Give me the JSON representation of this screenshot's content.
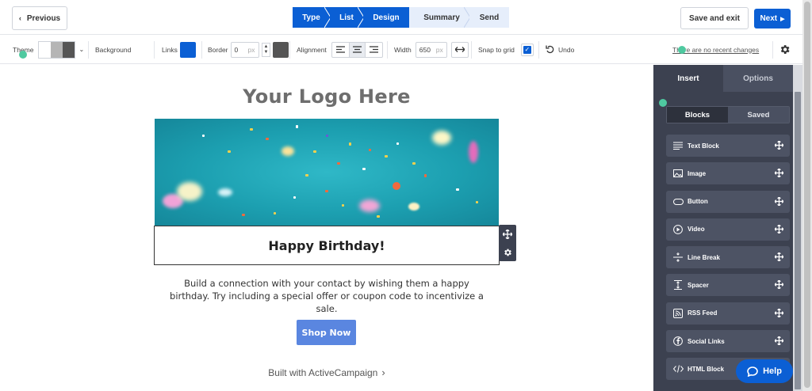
{
  "topbar": {
    "previous_label": "Previous",
    "steps": [
      {
        "label": "Type",
        "state": "done"
      },
      {
        "label": "List",
        "state": "done"
      },
      {
        "label": "Design",
        "state": "current"
      },
      {
        "label": "Summary",
        "state": "upcoming"
      },
      {
        "label": "Send",
        "state": "upcoming"
      }
    ],
    "save_exit_label": "Save and exit",
    "next_label": "Next"
  },
  "toolbar": {
    "theme_label": "Theme",
    "background_label": "Background",
    "links_label": "Links",
    "links_color": "#0b5fd4",
    "border_label": "Border",
    "border_value": "0",
    "border_unit": "px",
    "alignment_label": "Alignment",
    "width_label": "Width",
    "width_value": "650",
    "width_unit": "px",
    "snap_label": "Snap to grid",
    "snap_checked": true,
    "undo_label": "Undo",
    "recent_changes": "There are no recent changes"
  },
  "email": {
    "logo_text": "Your Logo Here",
    "headline": "Happy Birthday!",
    "body": "Build a connection with your contact by wishing them a happy birthday. Try including a special offer or coupon code to incentivize a sale.",
    "cta_label": "Shop Now",
    "footer": "Built with ActiveCampaign"
  },
  "panel": {
    "tabs": [
      "Insert",
      "Options"
    ],
    "active_tab": "Insert",
    "segments": [
      "Blocks",
      "Saved"
    ],
    "active_segment": "Blocks",
    "blocks": [
      {
        "label": "Text Block",
        "icon": "text-lines-icon"
      },
      {
        "label": "Image",
        "icon": "image-icon"
      },
      {
        "label": "Button",
        "icon": "button-pill-icon"
      },
      {
        "label": "Video",
        "icon": "play-circle-icon"
      },
      {
        "label": "Line Break",
        "icon": "line-break-icon"
      },
      {
        "label": "Spacer",
        "icon": "spacer-icon"
      },
      {
        "label": "RSS Feed",
        "icon": "rss-icon"
      },
      {
        "label": "Social Links",
        "icon": "social-icon"
      },
      {
        "label": "HTML Block",
        "icon": "code-icon"
      }
    ]
  },
  "help_label": "Help"
}
